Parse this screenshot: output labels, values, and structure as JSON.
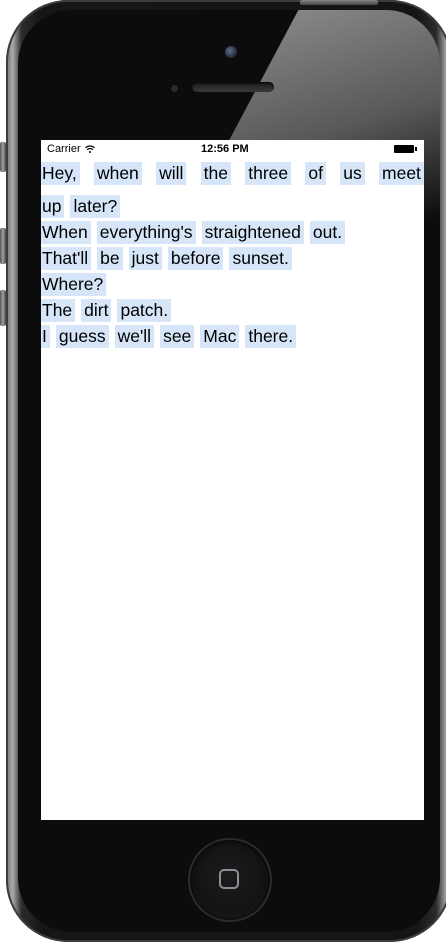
{
  "status_bar": {
    "carrier": "Carrier",
    "time": "12:56 PM"
  },
  "icons": {
    "wifi": "wifi-icon",
    "battery": "battery-icon",
    "home": "home-button-square-icon"
  },
  "colors": {
    "word_highlight": "#d6e6f8",
    "screen_background": "#ffffff",
    "phone_body": "#141515"
  },
  "text_lines": [
    {
      "words": [
        "Hey,",
        "when",
        "will",
        "the",
        "three",
        "of",
        "us",
        "meet"
      ]
    },
    {
      "words": [
        "up",
        "later?"
      ]
    },
    {
      "words": [
        "When",
        "everything's",
        "straightened",
        "out."
      ]
    },
    {
      "words": [
        "That'll",
        "be",
        "just",
        "before",
        "sunset."
      ]
    },
    {
      "words": [
        "Where?"
      ]
    },
    {
      "words": [
        "The",
        "dirt",
        "patch."
      ]
    },
    {
      "words": [
        "I",
        "guess",
        "we'll",
        "see",
        "Mac",
        "there."
      ]
    }
  ]
}
